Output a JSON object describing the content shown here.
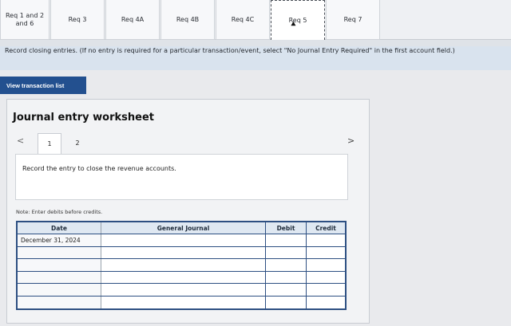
{
  "tabs": [
    {
      "label": "Req 1 and 2 and 6"
    },
    {
      "label": "Req 3"
    },
    {
      "label": "Req 4A"
    },
    {
      "label": "Req 4B"
    },
    {
      "label": "Req 4C"
    },
    {
      "label": "Req 5"
    },
    {
      "label": "Req 7"
    }
  ],
  "active_tab": "Req 5",
  "instructions": "Record closing entries. (If no entry is required for a particular transaction/event, select \"No Journal Entry Required\" in the first account field.)",
  "view_button": "View transaction list",
  "worksheet": {
    "title": "Journal entry worksheet",
    "prev_icon": "<",
    "next_icon": ">",
    "pages": [
      "1",
      "2"
    ],
    "entry_text": "Record the entry to close the revenue accounts.",
    "note": "Note: Enter debits before credits."
  },
  "journal": {
    "headers": {
      "date": "Date",
      "general_journal": "General Journal",
      "debit": "Debit",
      "credit": "Credit"
    },
    "rows": [
      {
        "date": "December 31, 2024",
        "account": "",
        "debit": "",
        "credit": ""
      },
      {
        "date": "",
        "account": "",
        "debit": "",
        "credit": ""
      },
      {
        "date": "",
        "account": "",
        "debit": "",
        "credit": ""
      },
      {
        "date": "",
        "account": "",
        "debit": "",
        "credit": ""
      },
      {
        "date": "",
        "account": "",
        "debit": "",
        "credit": ""
      },
      {
        "date": "",
        "account": "",
        "debit": "",
        "credit": ""
      }
    ]
  },
  "colors": {
    "button": "#23508f",
    "table_border": "#2d4f82",
    "instruction_bg": "#d9e3ee"
  }
}
